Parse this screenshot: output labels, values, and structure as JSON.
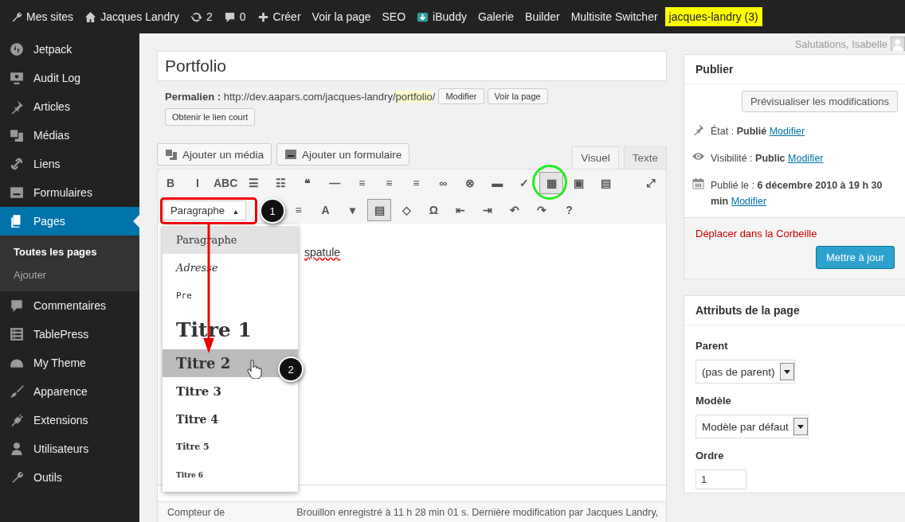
{
  "admin_bar": {
    "items": [
      {
        "kind": "wrench",
        "label": "Mes sites"
      },
      {
        "kind": "home",
        "label": "Jacques Landry"
      },
      {
        "kind": "sync",
        "label": "2"
      },
      {
        "kind": "comment",
        "label": "0"
      },
      {
        "kind": "plus",
        "label": "Créer"
      },
      {
        "kind": "text",
        "label": "Voir la page"
      },
      {
        "kind": "text",
        "label": "SEO"
      },
      {
        "kind": "app",
        "label": "iBuddy"
      },
      {
        "kind": "text",
        "label": "Galerie"
      },
      {
        "kind": "text",
        "label": "Builder"
      },
      {
        "kind": "text",
        "label": "Multisite Switcher"
      },
      {
        "kind": "highlight",
        "label": "jacques-landry (3)"
      }
    ]
  },
  "greeting": "Salutations, Isabelle",
  "sidebar": {
    "items": [
      {
        "kind": "circle",
        "label": "Jetpack",
        "selected": false
      },
      {
        "kind": "monitor",
        "label": "Audit Log",
        "selected": false
      },
      {
        "kind": "pin",
        "label": "Articles",
        "selected": false
      },
      {
        "kind": "media",
        "label": "Médias",
        "selected": false
      },
      {
        "kind": "link",
        "label": "Liens",
        "selected": false
      },
      {
        "kind": "form",
        "label": "Formulaires",
        "selected": false
      },
      {
        "kind": "pages",
        "label": "Pages",
        "selected": true,
        "children": [
          {
            "label": "Toutes les pages",
            "selected": true
          },
          {
            "label": "Ajouter",
            "selected": false
          }
        ]
      },
      {
        "kind": "comment",
        "label": "Commentaires",
        "selected": false
      },
      {
        "kind": "table",
        "label": "TablePress",
        "selected": false
      },
      {
        "kind": "helmet",
        "label": "My Theme",
        "selected": false
      },
      {
        "kind": "brush",
        "label": "Apparence",
        "selected": false
      },
      {
        "kind": "plug",
        "label": "Extensions",
        "selected": false
      },
      {
        "kind": "user",
        "label": "Utilisateurs",
        "selected": false
      },
      {
        "kind": "wrench",
        "label": "Outils",
        "selected": false
      }
    ]
  },
  "editor": {
    "title": "Portfolio",
    "permalink": {
      "label": "Permalien :",
      "url_start": "http://dev.aapars.com/jacques-landry/",
      "slug": "portfolio",
      "url_end": "/",
      "buttons": [
        "Modifier",
        "Voir la page"
      ],
      "shortlink": "Obtenir le lien court"
    },
    "media_buttons": [
      {
        "kind": "media",
        "label": "Ajouter un média"
      },
      {
        "kind": "form",
        "label": "Ajouter un formulaire"
      }
    ],
    "tabs": [
      {
        "label": "Visuel",
        "selected": true
      },
      {
        "label": "Texte",
        "selected": false
      }
    ],
    "toolbar_row1": [
      {
        "glyph": "B",
        "pressed": false
      },
      {
        "glyph": "I",
        "pressed": false
      },
      {
        "glyph": "ABC",
        "pressed": false
      },
      {
        "glyph": "☰",
        "pressed": false
      },
      {
        "glyph": "☷",
        "pressed": false
      },
      {
        "glyph": "❝",
        "pressed": false
      },
      {
        "glyph": "—",
        "pressed": false
      },
      {
        "glyph": "≡",
        "pressed": false
      },
      {
        "glyph": "≡",
        "pressed": false
      },
      {
        "glyph": "≡",
        "pressed": false
      },
      {
        "glyph": "∞",
        "pressed": false
      },
      {
        "glyph": "⊗",
        "pressed": false
      },
      {
        "glyph": "▬",
        "pressed": false
      },
      {
        "glyph": "✓",
        "pressed": false
      },
      {
        "glyph": "▦",
        "pressed": true
      },
      {
        "glyph": "▣",
        "pressed": false
      },
      {
        "glyph": "▤",
        "pressed": false
      }
    ],
    "fullscreen_glyph": "⤢",
    "format_select": {
      "value": "Paragraphe",
      "caret": "▲"
    },
    "toolbar_row2": [
      {
        "glyph": "≡",
        "pressed": false
      },
      {
        "glyph": "A",
        "pressed": false
      },
      {
        "glyph": "▾",
        "pressed": false
      },
      {
        "glyph": "▤",
        "pressed": true
      },
      {
        "glyph": "◇",
        "pressed": false
      },
      {
        "glyph": "Ω",
        "pressed": false
      },
      {
        "glyph": "⇤",
        "pressed": false
      },
      {
        "glyph": "⇥",
        "pressed": false
      },
      {
        "glyph": "↶",
        "pressed": false
      },
      {
        "glyph": "↷",
        "pressed": false
      },
      {
        "glyph": "?",
        "pressed": false
      }
    ],
    "content": "spatule",
    "format_menu": [
      {
        "kind": "p",
        "label": "Paragraphe",
        "selected": true,
        "hovered": false
      },
      {
        "kind": "address",
        "label": "Adresse",
        "selected": false,
        "hovered": false
      },
      {
        "kind": "pre",
        "label": "Pre",
        "selected": false,
        "hovered": false
      },
      {
        "kind": "h1",
        "label": "Titre 1",
        "selected": false,
        "hovered": false
      },
      {
        "kind": "h2",
        "label": "Titre 2",
        "selected": false,
        "hovered": true
      },
      {
        "kind": "h3",
        "label": "Titre 3",
        "selected": false,
        "hovered": false
      },
      {
        "kind": "h4",
        "label": "Titre 4",
        "selected": false,
        "hovered": false
      },
      {
        "kind": "h5",
        "label": "Titre 5",
        "selected": false,
        "hovered": false
      },
      {
        "kind": "h6",
        "label": "Titre 6",
        "selected": false,
        "hovered": false
      }
    ],
    "status": {
      "counter": "Compteur de",
      "saved": "Brouillon enregistré à 11 h 28 min 01 s. Dernière modification par Jacques Landry,"
    },
    "callouts": [
      "1",
      "2"
    ]
  },
  "publish": {
    "title": "Publier",
    "preview": "Prévisualiser les modifications",
    "rows": [
      {
        "kind": "pin",
        "label": "État :",
        "value": "Publié",
        "link": "Modifier"
      },
      {
        "kind": "eye",
        "label": "Visibilité :",
        "value": "Public",
        "link": "Modifier"
      },
      {
        "kind": "calendar",
        "label": "Publié le :",
        "value": "6 décembre 2010 à 19 h 30 min",
        "link": "Modifier"
      }
    ],
    "trash": "Déplacer dans la Corbeille",
    "update": "Mettre à jour"
  },
  "attributes": {
    "title": "Attributs de la page",
    "parent_label": "Parent",
    "parent": "(pas de parent)",
    "template_label": "Modèle",
    "template": "Modèle par défaut",
    "order_label": "Ordre",
    "order": "1"
  }
}
